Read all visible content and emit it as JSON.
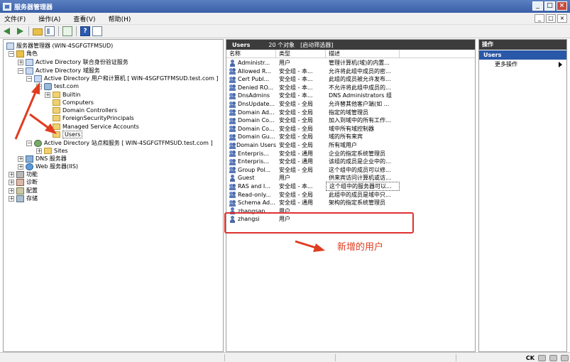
{
  "window": {
    "title": "服务器管理器"
  },
  "menu": [
    "文件(F)",
    "操作(A)",
    "查看(V)",
    "帮助(H)"
  ],
  "window_buttons": [
    "_",
    "□",
    "×"
  ],
  "mdi_buttons": [
    "_",
    "□",
    "×"
  ],
  "tree": [
    {
      "label": "服务器管理器 (WIN-4SGFGTFMSUD)",
      "icon": "root-icon",
      "expander": ""
    },
    {
      "label": "角色",
      "icon": "roles-icon",
      "expander": "−"
    },
    {
      "label": "Active Directory 联合身份验证服务",
      "icon": "ad-icon",
      "expander": "+"
    },
    {
      "label": "Active Directory 域服务",
      "icon": "ad-icon",
      "expander": "−"
    },
    {
      "label": "Active Directory 用户和计算机 [ WIN-4SGFGTFMSUD.test.com ]",
      "icon": "ad-icon",
      "expander": "−"
    },
    {
      "label": "test.com",
      "icon": "domain-icon",
      "expander": "−"
    },
    {
      "label": "Builtin",
      "icon": "folder-icon",
      "expander": "+"
    },
    {
      "label": "Computers",
      "icon": "folder-icon",
      "expander": ""
    },
    {
      "label": "Domain Controllers",
      "icon": "folder-icon",
      "expander": ""
    },
    {
      "label": "ForeignSecurityPrincipals",
      "icon": "folder-icon",
      "expander": ""
    },
    {
      "label": "Managed Service Accounts",
      "icon": "folder-icon",
      "expander": ""
    },
    {
      "label": "Users",
      "icon": "folder-icon",
      "expander": ""
    },
    {
      "label": "Active Directory 站点和服务 [ WIN-4SGFGTFMSUD.test.com ]",
      "icon": "sites-icon",
      "expander": "−"
    },
    {
      "label": "Sites",
      "icon": "folder-icon",
      "expander": "+"
    },
    {
      "label": "DNS 服务器",
      "icon": "dns-icon",
      "expander": "+"
    },
    {
      "label": "Web 服务器(IIS)",
      "icon": "web-icon",
      "expander": "+"
    },
    {
      "label": "功能",
      "icon": "func-icon",
      "expander": "+"
    },
    {
      "label": "诊断",
      "icon": "diag-icon",
      "expander": "+"
    },
    {
      "label": "配置",
      "icon": "cfg-icon",
      "expander": "+"
    },
    {
      "label": "存储",
      "icon": "store-icon",
      "expander": "+"
    }
  ],
  "list": {
    "title": "Users",
    "count": "20 个对象",
    "filter": "[启动筛选器]",
    "columns": [
      "名称",
      "类型",
      "描述"
    ],
    "rows": [
      {
        "name": "Administr...",
        "type": "用户",
        "desc": "管理计算机(域)的内置...",
        "kind": "user"
      },
      {
        "name": "Allowed R...",
        "type": "安全组 - 本...",
        "desc": "允许将此组中成员的密...",
        "kind": "group"
      },
      {
        "name": "Cert Publ...",
        "type": "安全组 - 本...",
        "desc": "此组的成员被允许发布...",
        "kind": "group"
      },
      {
        "name": "Denied RO...",
        "type": "安全组 - 本...",
        "desc": "不允许将此组中成员的...",
        "kind": "group"
      },
      {
        "name": "DnsAdmins",
        "type": "安全组 - 本...",
        "desc": "DNS Administrators 组",
        "kind": "group"
      },
      {
        "name": "DnsUpdate...",
        "type": "安全组 - 全局",
        "desc": "允许替其他客户端(如 ...",
        "kind": "group"
      },
      {
        "name": "Domain Ad...",
        "type": "安全组 - 全局",
        "desc": "指定的域管理员",
        "kind": "group"
      },
      {
        "name": "Domain Co...",
        "type": "安全组 - 全局",
        "desc": "加入到域中的所有工作...",
        "kind": "group"
      },
      {
        "name": "Domain Co...",
        "type": "安全组 - 全局",
        "desc": "域中所有域控制器",
        "kind": "group"
      },
      {
        "name": "Domain Gu...",
        "type": "安全组 - 全局",
        "desc": "域的所有来宾",
        "kind": "group"
      },
      {
        "name": "Domain Users",
        "type": "安全组 - 全局",
        "desc": "所有域用户",
        "kind": "group"
      },
      {
        "name": "Enterpris...",
        "type": "安全组 - 通用",
        "desc": "企业的指定系统管理员",
        "kind": "group"
      },
      {
        "name": "Enterpris...",
        "type": "安全组 - 通用",
        "desc": "该组的成员是企业中的...",
        "kind": "group"
      },
      {
        "name": "Group Pol...",
        "type": "安全组 - 全局",
        "desc": "这个组中的成员可以修...",
        "kind": "group"
      },
      {
        "name": "Guest",
        "type": "用户",
        "desc": "供来宾访问计算机或访...",
        "kind": "user"
      },
      {
        "name": "RAS and I...",
        "type": "安全组 - 本...",
        "desc": "这个组中的服务器可以...",
        "kind": "group"
      },
      {
        "name": "Read-only...",
        "type": "安全组 - 全局",
        "desc": "此组中的成员是域中只...",
        "kind": "group"
      },
      {
        "name": "Schema Ad...",
        "type": "安全组 - 通用",
        "desc": "架构的指定系统管理员",
        "kind": "group"
      },
      {
        "name": "zhangsan",
        "type": "用户",
        "desc": "",
        "kind": "user"
      },
      {
        "name": "zhangsi",
        "type": "用户",
        "desc": "",
        "kind": "user"
      }
    ]
  },
  "annotation": {
    "text": "新增的用户",
    "color": "#e03c20"
  },
  "actions": {
    "title": "操作",
    "section": "Users",
    "items": [
      "更多操作"
    ]
  },
  "status": {
    "tray_label": "CK"
  },
  "colors": {
    "accent": "#2a58a8",
    "highlight": "#e03030",
    "header": "#3c3c3c"
  }
}
